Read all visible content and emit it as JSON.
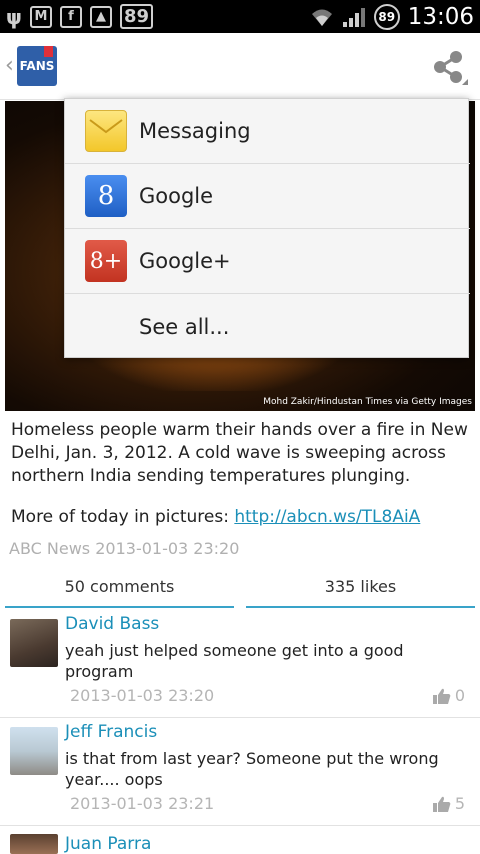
{
  "status_bar": {
    "left_icons": [
      "usb-icon",
      "gmail-icon",
      "facebook-icon",
      "gallery-icon"
    ],
    "notification_count": "89",
    "battery_level": "89",
    "time": "13:06"
  },
  "action_bar": {
    "app_icon_label": "FANS"
  },
  "share_menu": {
    "items": [
      {
        "label": "Messaging",
        "icon": "messaging-icon"
      },
      {
        "label": "Google",
        "icon": "google-icon",
        "glyph": "8"
      },
      {
        "label": "Google+",
        "icon": "google-plus-icon",
        "glyph": "8+"
      },
      {
        "label": "See all...",
        "icon": ""
      }
    ]
  },
  "post": {
    "photo_credit": "Mohd Zakir/Hindustan Times via Getty Images",
    "caption": "Homeless people warm their hands over a fire in New Delhi, Jan. 3, 2012. A cold wave is sweeping across northern India sending temperatures plunging.",
    "more_prefix": "More of today in pictures: ",
    "more_link": "http://abcn.ws/TL8AiA",
    "source": "ABC News",
    "timestamp": "2013-01-03 23:20"
  },
  "tabs": {
    "comments": "50 comments",
    "likes": "335 likes"
  },
  "comments": [
    {
      "name": "David Bass",
      "text": "yeah just helped someone get into a good program",
      "time": "2013-01-03 23:20",
      "likes": "0"
    },
    {
      "name": "Jeff Francis",
      "text": "is that from last year? Someone put the wrong year.... oops",
      "time": "2013-01-03 23:21",
      "likes": "5"
    },
    {
      "name": "Juan Parra",
      "text": "",
      "time": "",
      "likes": ""
    }
  ],
  "colors": {
    "accent": "#1b8fb8",
    "tab_underline": "#39a3c9"
  }
}
